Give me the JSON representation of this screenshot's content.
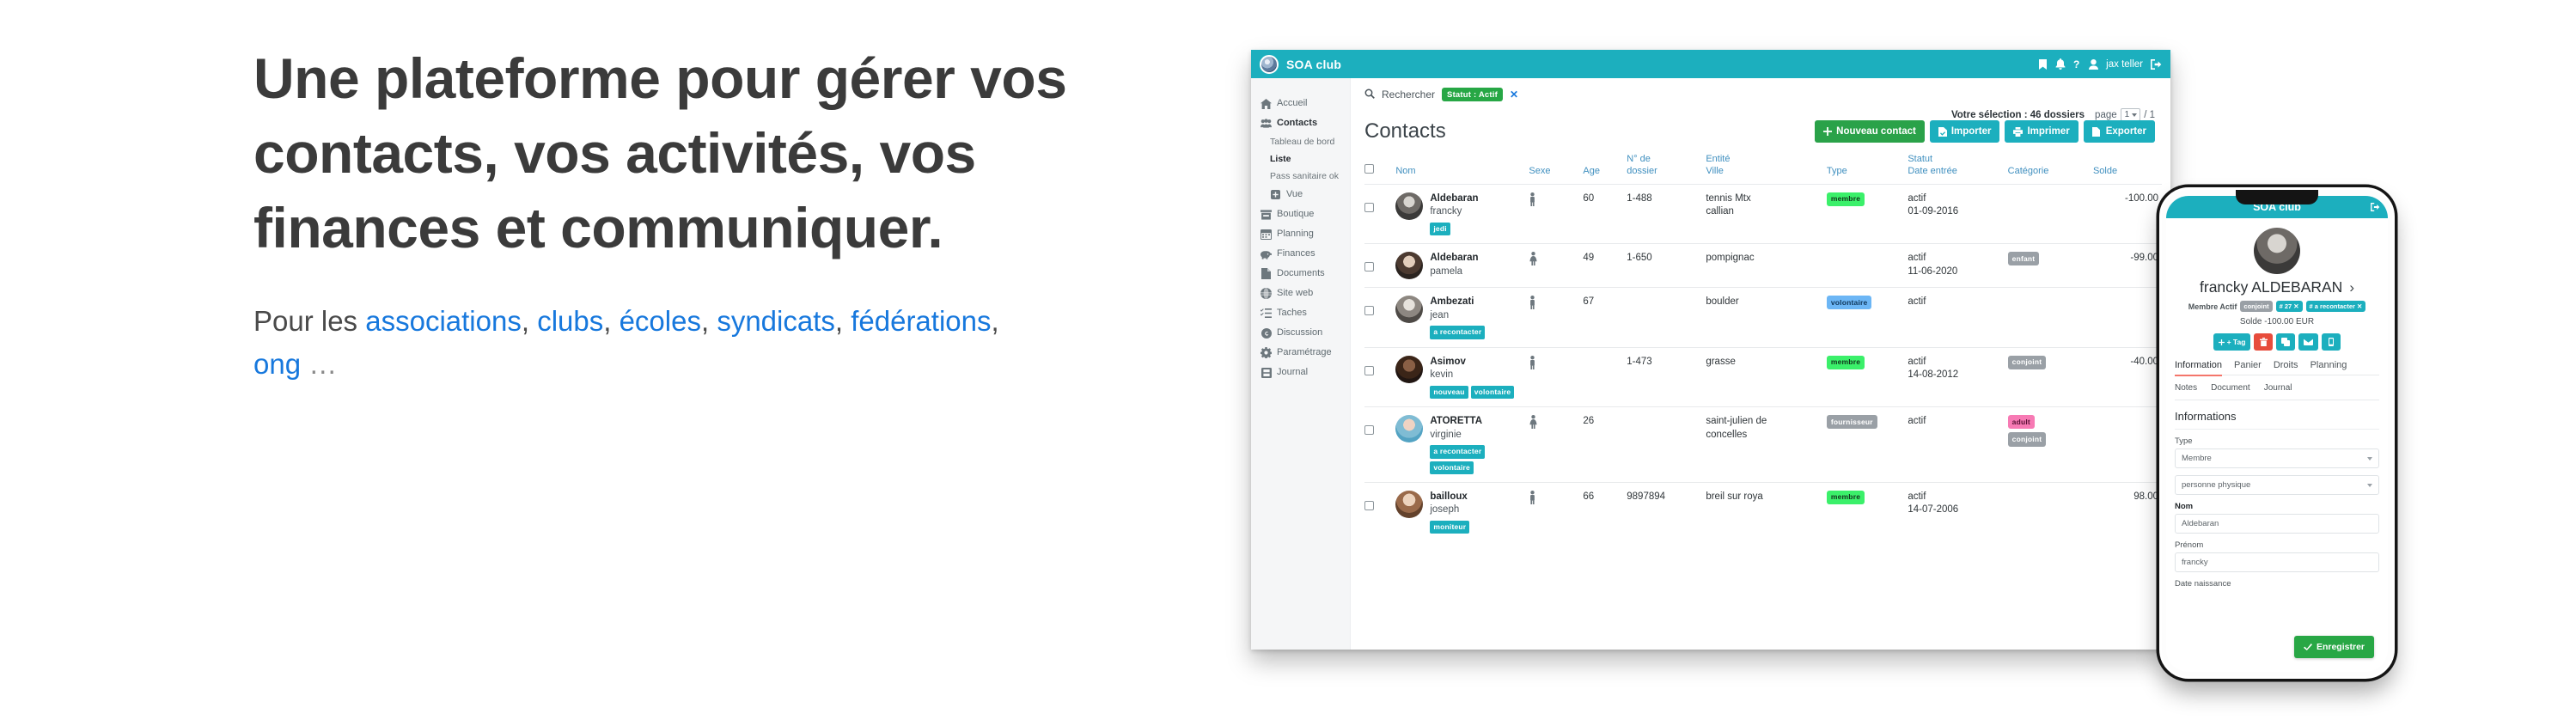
{
  "hero": {
    "heading": "Une plateforme pour gérer vos contacts, vos activités, vos finances et communiquer.",
    "sub_prefix": "Pour les ",
    "links": [
      "associations",
      "clubs",
      "écoles",
      "syndicats",
      "fédérations",
      "ong"
    ],
    "sub_suffix": "…"
  },
  "colors": {
    "teal": "#1CAFBE",
    "green": "#2aa249",
    "link_blue": "#1778dd",
    "heading_grey": "#3b3b3b",
    "badge_green": "#3bf06a",
    "accent_red": "#f4766b"
  },
  "desktop": {
    "topbar": {
      "brand": "SOA club",
      "user": "jax teller",
      "icons": [
        "bookmark-icon",
        "bell-icon",
        "help-icon",
        "user-icon",
        "logout-icon"
      ]
    },
    "sidebar": {
      "items": [
        {
          "label": "Accueil",
          "icon": "home-icon",
          "type": "main"
        },
        {
          "label": "Contacts",
          "icon": "contacts-icon",
          "type": "main"
        },
        {
          "label": "Tableau de bord",
          "icon": "",
          "type": "sub"
        },
        {
          "label": "Liste",
          "icon": "",
          "type": "sub",
          "active": true
        },
        {
          "label": "Pass sanitaire ok",
          "icon": "",
          "type": "sub"
        },
        {
          "label": "Vue",
          "icon": "plus-square-icon",
          "type": "sub-icon"
        },
        {
          "label": "Boutique",
          "icon": "shop-icon",
          "type": "main"
        },
        {
          "label": "Planning",
          "icon": "calendar-icon",
          "type": "main"
        },
        {
          "label": "Finances",
          "icon": "piggy-bank-icon",
          "type": "main"
        },
        {
          "label": "Documents",
          "icon": "document-icon",
          "type": "main"
        },
        {
          "label": "Site web",
          "icon": "globe-icon",
          "type": "main"
        },
        {
          "label": "Taches",
          "icon": "tasks-icon",
          "type": "main"
        },
        {
          "label": "Discussion",
          "icon": "discussion-icon",
          "type": "main"
        },
        {
          "label": "Paramétrage",
          "icon": "gear-icon",
          "type": "main"
        },
        {
          "label": "Journal",
          "icon": "journal-icon",
          "type": "main"
        }
      ]
    },
    "search": {
      "label": "Rechercher",
      "filter_chip": "Statut : Actif",
      "chip_remove": "✕"
    },
    "selection": {
      "text": "Votre sélection : 46 dossiers",
      "page_label": "page",
      "page_value": "1",
      "page_total": "/ 1"
    },
    "page_title": "Contacts",
    "buttons": [
      {
        "label": "Nouveau contact",
        "icon": "plus-icon",
        "style": "green"
      },
      {
        "label": "Importer",
        "icon": "import-icon",
        "style": "teal"
      },
      {
        "label": "Imprimer",
        "icon": "print-icon",
        "style": "teal"
      },
      {
        "label": "Exporter",
        "icon": "export-icon",
        "style": "teal"
      }
    ],
    "table": {
      "headers": [
        {
          "l1": "",
          "l2": ""
        },
        {
          "l1": "",
          "l2": "Nom"
        },
        {
          "l1": "",
          "l2": "Sexe"
        },
        {
          "l1": "",
          "l2": "Age"
        },
        {
          "l1": "N° de",
          "l2": "dossier"
        },
        {
          "l1": "Entité",
          "l2": "Ville"
        },
        {
          "l1": "",
          "l2": "Type"
        },
        {
          "l1": "Statut",
          "l2": "Date entrée"
        },
        {
          "l1": "",
          "l2": "Catégorie"
        },
        {
          "l1": "",
          "l2": "Solde"
        }
      ],
      "rows": [
        {
          "name": "Aldebaran",
          "firstname": "francky",
          "tags": [
            "jedi"
          ],
          "sex": "male",
          "age": "60",
          "dossier": "1-488",
          "entity": "tennis Mtx",
          "city": "callian",
          "type": "membre",
          "type_style": "b-green",
          "statut": "actif",
          "date": "01-09-2016",
          "categories": [],
          "solde": "-100.00"
        },
        {
          "name": "Aldebaran",
          "firstname": "pamela",
          "tags": [],
          "sex": "female",
          "age": "49",
          "dossier": "1-650",
          "entity": "pompignac",
          "city": "",
          "type": "",
          "type_style": "",
          "statut": "actif",
          "date": "11-06-2020",
          "categories": [
            {
              "label": "enfant",
              "style": "b-grey"
            }
          ],
          "solde": "-99.00"
        },
        {
          "name": "Ambezati",
          "firstname": "jean",
          "tags": [
            "a recontacter"
          ],
          "sex": "male",
          "age": "67",
          "dossier": "",
          "entity": "boulder",
          "city": "",
          "type": "volontaire",
          "type_style": "b-blue",
          "statut": "actif",
          "date": "",
          "categories": [],
          "solde": ""
        },
        {
          "name": "Asimov",
          "firstname": "kevin",
          "tags": [
            "nouveau",
            "volontaire"
          ],
          "sex": "male",
          "age": "",
          "dossier": "1-473",
          "entity": "grasse",
          "city": "",
          "type": "membre",
          "type_style": "b-green",
          "statut": "actif",
          "date": "14-08-2012",
          "categories": [
            {
              "label": "conjoint",
              "style": "b-grey"
            }
          ],
          "solde": "-40.00"
        },
        {
          "name": "ATORETTA",
          "firstname": "virginie",
          "tags": [
            "a recontacter",
            "volontaire"
          ],
          "sex": "female",
          "age": "26",
          "dossier": "",
          "entity": "saint-julien de",
          "city": "concelles",
          "type": "fournisseur",
          "type_style": "b-grey",
          "statut": "actif",
          "date": "",
          "categories": [
            {
              "label": "adult",
              "style": "b-pink"
            },
            {
              "label": "conjoint",
              "style": "b-grey"
            }
          ],
          "solde": ""
        },
        {
          "name": "bailloux",
          "firstname": "joseph",
          "tags": [
            "moniteur"
          ],
          "sex": "male",
          "age": "66",
          "dossier": "9897894",
          "entity": "breil sur roya",
          "city": "",
          "type": "membre",
          "type_style": "b-green",
          "statut": "actif",
          "date": "14-07-2006",
          "categories": [],
          "solde": "98.00"
        }
      ]
    }
  },
  "phone": {
    "topbar": {
      "brand": "SOA club",
      "logout_icon": "logout-icon"
    },
    "contact": {
      "name": "francky ALDEBARAN",
      "chevron": "›",
      "status": "Membre Actif",
      "badges": [
        {
          "label": "conjoint",
          "style": "pb-grey"
        },
        {
          "label": "# 27 ✕",
          "style": "pb-teal"
        },
        {
          "label": "# a recontacter ✕",
          "style": "pb-teal"
        }
      ],
      "solde": "Solde -100.00 EUR"
    },
    "actions": [
      {
        "label": "+ Tag",
        "icon": "tag-icon",
        "style": "teal"
      },
      {
        "label": "",
        "icon": "trash-icon",
        "style": "red"
      },
      {
        "label": "",
        "icon": "copy-icon",
        "style": "teal"
      },
      {
        "label": "",
        "icon": "envelope-icon",
        "style": "teal"
      },
      {
        "label": "",
        "icon": "mobile-icon",
        "style": "teal"
      }
    ],
    "tabs": [
      "Information",
      "Panier",
      "Droits",
      "Planning"
    ],
    "tabs2": [
      "Notes",
      "Document",
      "Journal"
    ],
    "section_title": "Informations",
    "fields": [
      {
        "label": "Type",
        "value": "Membre",
        "kind": "select",
        "bold": false
      },
      {
        "label": "",
        "value": "personne physique",
        "kind": "select",
        "bold": false
      },
      {
        "label": "Nom",
        "value": "Aldebaran",
        "kind": "text",
        "bold": true
      },
      {
        "label": "Prénom",
        "value": "francky",
        "kind": "text",
        "bold": false
      },
      {
        "label": "Date naissance",
        "value": "",
        "kind": "label-only",
        "bold": false
      }
    ],
    "save_label": "Enregistrer"
  }
}
